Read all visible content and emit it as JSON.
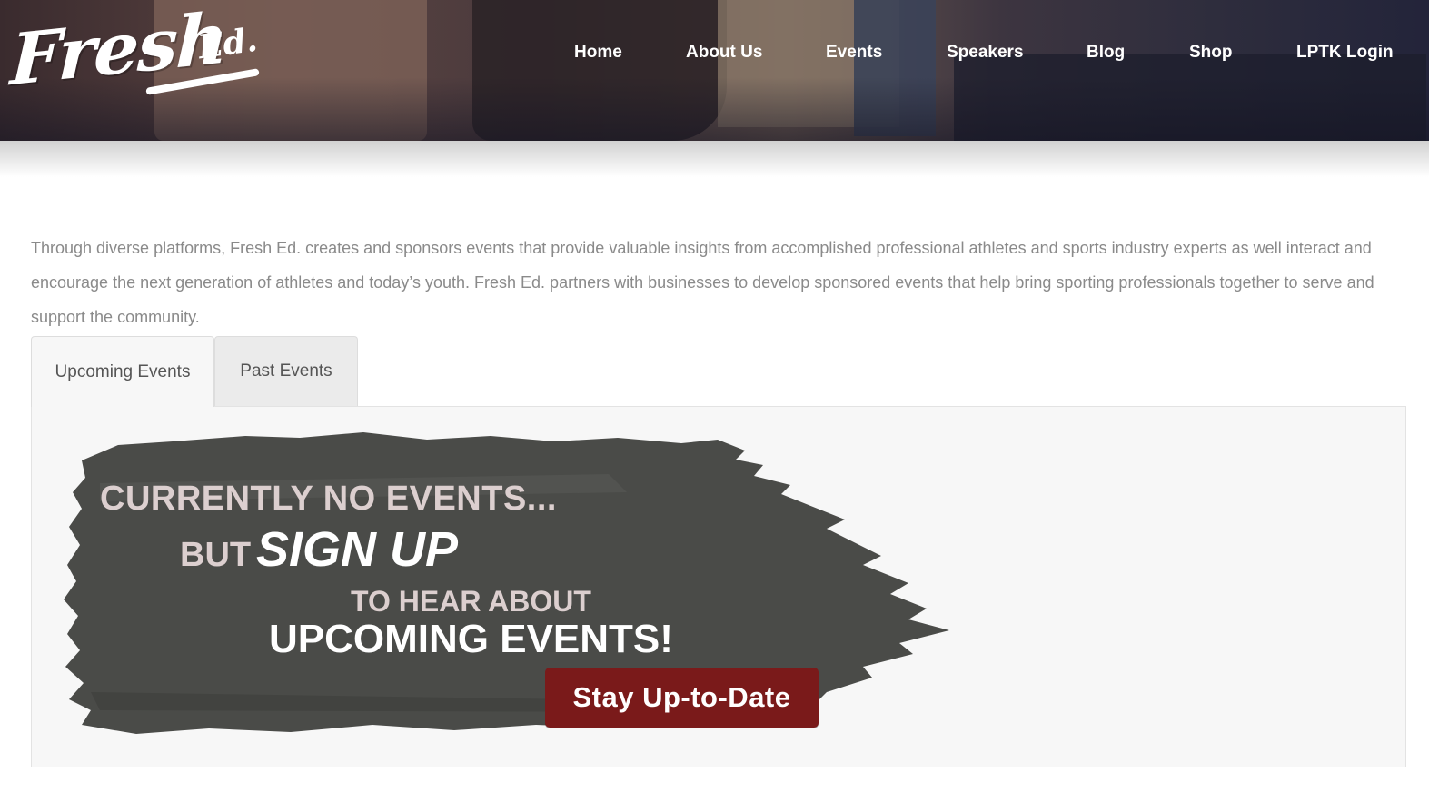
{
  "header": {
    "logo": {
      "main": "Fresh",
      "sub": "Ed."
    },
    "nav": [
      "Home",
      "About Us",
      "Events",
      "Speakers",
      "Blog",
      "Shop",
      "LPTK Login"
    ]
  },
  "intro": {
    "text": "Through diverse platforms, Fresh Ed. creates and sponsors events that provide valuable insights from accomplished professional athletes and sports industry experts as well interact and  encourage the next generation of athletes and today’s youth. Fresh Ed. partners with businesses to develop sponsored events that help bring sporting professionals together to serve and support  the community."
  },
  "tabs": {
    "upcoming": "Upcoming Events",
    "past": "Past Events",
    "active": "Upcoming Events"
  },
  "banner": {
    "line1": "CURRENTLY NO EVENTS...",
    "line2a": "BUT",
    "line2b": "SIGN UP",
    "line3": "TO HEAR ABOUT",
    "line4": "UPCOMING EVENTS!",
    "cta": "Stay Up-to-Date"
  },
  "colors": {
    "nav_text": "#ffffff",
    "intro_text": "#8a8a8a",
    "cta_background": "#7a1a1a",
    "brush": "#4a4b48",
    "panel_background": "#f7f7f7"
  }
}
